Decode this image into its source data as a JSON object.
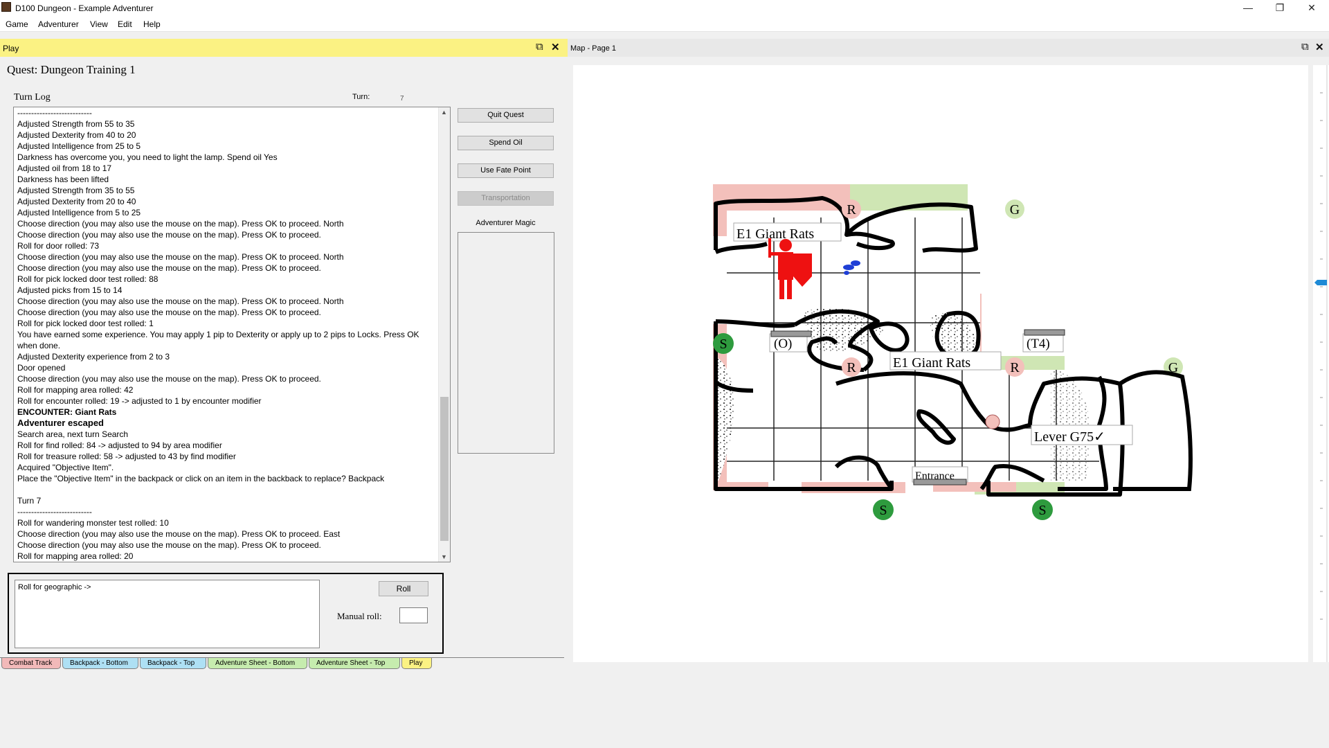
{
  "window": {
    "title": "D100 Dungeon - Example Adventurer"
  },
  "menu": [
    "Game",
    "Adventurer",
    "View",
    "Edit",
    "Help"
  ],
  "play": {
    "panel_title": "Play",
    "quest_title": "Quest:  Dungeon Training 1",
    "turn_log_label": "Turn Log",
    "turn_label": "Turn:",
    "turn_value": "7",
    "log": [
      {
        "t": "---------------------------"
      },
      {
        "t": "Adjusted Strength from 55 to 35"
      },
      {
        "t": "Adjusted Dexterity from 40 to 20"
      },
      {
        "t": "Adjusted Intelligence from 25 to 5"
      },
      {
        "t": "Darkness has overcome you, you need to light the lamp. Spend oil Yes"
      },
      {
        "t": "Adjusted oil from 18 to 17"
      },
      {
        "t": "Darkness has been lifted"
      },
      {
        "t": "Adjusted Strength from 35 to 55"
      },
      {
        "t": "Adjusted Dexterity from 20 to 40"
      },
      {
        "t": "Adjusted Intelligence from 5 to 25"
      },
      {
        "t": "Choose direction (you may also use the mouse on the map). Press OK to proceed. North"
      },
      {
        "t": "Choose direction (you may also use the mouse on the map). Press OK to proceed."
      },
      {
        "t": "Roll for door rolled: 73"
      },
      {
        "t": "Choose direction (you may also use the mouse on the map). Press OK to proceed. North"
      },
      {
        "t": "Choose direction (you may also use the mouse on the map). Press OK to proceed."
      },
      {
        "t": "Roll for pick locked door test rolled: 88"
      },
      {
        "t": "Adjusted picks from 15 to 14"
      },
      {
        "t": "Choose direction (you may also use the mouse on the map). Press OK to proceed. North"
      },
      {
        "t": "Choose direction (you may also use the mouse on the map). Press OK to proceed."
      },
      {
        "t": "Roll for pick locked door test rolled: 1"
      },
      {
        "t": "You have earned some experience. You may apply 1 pip to Dexterity or apply up to 2 pips to Locks. Press OK when done."
      },
      {
        "t": "Adjusted Dexterity experience from 2 to 3"
      },
      {
        "t": "Door opened"
      },
      {
        "t": "Choose direction (you may also use the mouse on the map). Press OK to proceed."
      },
      {
        "t": "Roll for mapping area rolled: 42"
      },
      {
        "t": "Roll for encounter rolled: 19 -> adjusted to 1 by encounter modifier"
      },
      {
        "t": "ENCOUNTER: Giant Rats",
        "bold": true
      },
      {
        "t": "Adventurer escaped",
        "bold": true,
        "big": true
      },
      {
        "t": "Search area, next turn Search"
      },
      {
        "t": "Roll for find rolled: 84 -> adjusted to 94 by area modifier"
      },
      {
        "t": "Roll for treasure rolled: 58 -> adjusted to 43 by find modifier"
      },
      {
        "t": "Acquired \"Objective Item\"."
      },
      {
        "t": "Place the \"Objective Item\" in the backpack or click on an item in the backback to replace? Backpack"
      },
      {
        "t": ""
      },
      {
        "t": "Turn 7"
      },
      {
        "t": "---------------------------"
      },
      {
        "t": "Roll for wandering monster test rolled: 10"
      },
      {
        "t": "Choose direction (you may also use the mouse on the map). Press OK to proceed. East"
      },
      {
        "t": "Choose direction (you may also use the mouse on the map). Press OK to proceed."
      },
      {
        "t": "Roll for mapping area rolled: 20"
      }
    ],
    "buttons": {
      "quit_quest": "Quit Quest",
      "spend_oil": "Spend Oil",
      "use_fate": "Use Fate Point",
      "transportation": "Transportation"
    },
    "magic_label": "Adventurer Magic",
    "roll_text": "Roll for geographic ->",
    "roll_button": "Roll",
    "manual_roll_label": "Manual roll:"
  },
  "tabs": [
    {
      "label": "Combat Track",
      "color": "#f2b9b9"
    },
    {
      "label": "Backpack - Bottom",
      "color": "#aee0f4"
    },
    {
      "label": "Backpack - Top",
      "color": "#aee0f4"
    },
    {
      "label": "Adventure Sheet - Bottom",
      "color": "#c6ecae"
    },
    {
      "label": "Adventure Sheet - Top",
      "color": "#c6ecae"
    },
    {
      "label": "Play",
      "color": "#fbf283",
      "active": true
    }
  ],
  "map": {
    "panel_title": "Map - Page 1",
    "labels": {
      "e1_top": "E1 Giant Rats",
      "e1_mid": "E1 Giant Rats",
      "o": "(O)",
      "t4": "(T4)",
      "lever": "Lever G75✓",
      "entrance": "Entrance"
    },
    "markers": {
      "r": "R",
      "g": "G",
      "s": "S"
    },
    "colors": {
      "pink": "#f3c0bb",
      "green": "#cfe6b4",
      "marker_green": "#2e9b3e",
      "hero": "#ee1111"
    }
  },
  "colors": {
    "play_header": "#fbf283",
    "accent_blue": "#1e8ad6"
  }
}
